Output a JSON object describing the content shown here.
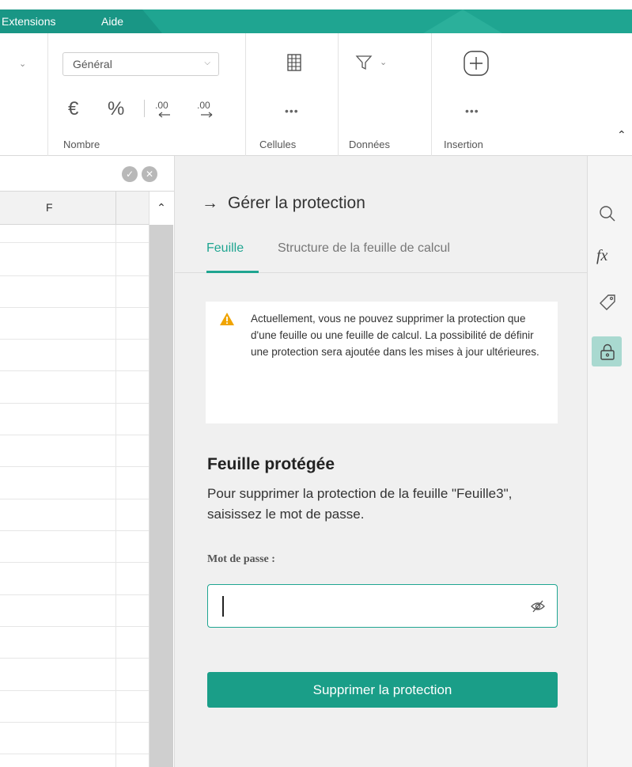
{
  "menubar": {
    "items": [
      "Extensions",
      "Aide"
    ]
  },
  "ribbon": {
    "number_format": {
      "selected": "Général",
      "group_label": "Nombre",
      "currency_symbol": "€",
      "percent_symbol": "%"
    },
    "cells": {
      "group_label": "Cellules",
      "more": "•••"
    },
    "data": {
      "group_label": "Données"
    },
    "insertion": {
      "group_label": "Insertion",
      "more": "•••"
    }
  },
  "sheet": {
    "column_header": "F"
  },
  "panel": {
    "title": "Gérer la protection",
    "tabs": [
      {
        "label": "Feuille",
        "active": true
      },
      {
        "label": "Structure de la feuille de calcul",
        "active": false
      }
    ],
    "warning_text": "Actuellement, vous ne pouvez supprimer la protection que d'une feuille ou une feuille de calcul. La possibilité de définir une protection sera ajoutée dans les mises à jour ultérieures.",
    "protected_title": "Feuille protégée",
    "protected_desc": "Pour supprimer la protection de la feuille \"Feuille3\", saisissez le mot de passe.",
    "password_label": "Mot de passe :",
    "password_value": "",
    "remove_button": "Supprimer la protection"
  },
  "colors": {
    "accent": "#1fa591",
    "button": "#1a9e88",
    "warning": "#f0a400",
    "active_tool": "#a9d9d0"
  },
  "right_toolbar": {
    "icons": [
      "search-icon",
      "function-icon",
      "tag-icon",
      "lock-icon"
    ],
    "active": "lock-icon",
    "function_glyph": "fx"
  }
}
